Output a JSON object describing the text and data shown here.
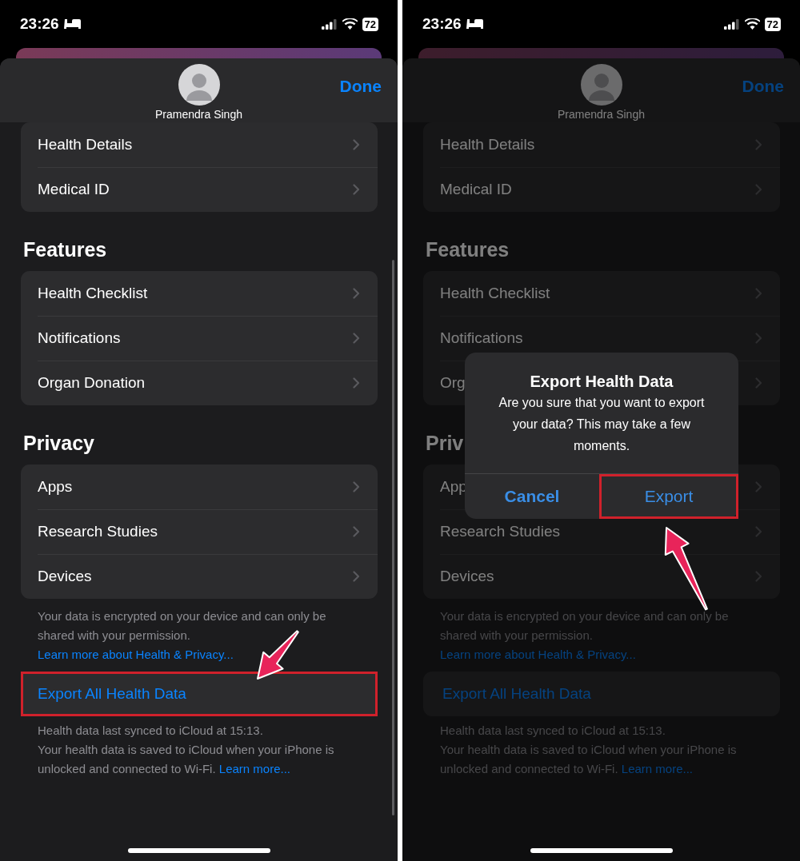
{
  "screens": [
    {
      "dimmed": false,
      "annotation": {
        "kind": "arrow-down"
      },
      "scroll_indicator": true,
      "status_bar": {
        "time": "23:26",
        "battery": "72"
      },
      "profile": {
        "name": "Pramendra Singh"
      },
      "done": "Done",
      "sections": [
        {
          "rows": [
            "Health Details",
            "Medical ID"
          ]
        },
        {
          "title": "Features",
          "rows": [
            "Health Checklist",
            "Notifications",
            "Organ Donation"
          ]
        },
        {
          "title": "Privacy",
          "rows": [
            "Apps",
            "Research Studies",
            "Devices"
          ],
          "footer": {
            "text": "Your data is encrypted on your device and can only be shared with your permission.",
            "link": "Learn more about Health & Privacy..."
          }
        }
      ],
      "export": {
        "label": "Export All Health Data",
        "highlighted": true
      },
      "sync_note": {
        "first_line": "Health data last synced to iCloud at 15:13.",
        "text": "Your health data is saved to iCloud when your iPhone is unlocked and connected to Wi-Fi.",
        "link": "Learn more..."
      }
    },
    {
      "dimmed": true,
      "annotation": {
        "kind": "arrow-up"
      },
      "scroll_indicator": false,
      "status_bar": {
        "time": "23:26",
        "battery": "72"
      },
      "profile": {
        "name": "Pramendra Singh"
      },
      "done": "Done",
      "sections": [
        {
          "rows": [
            "Health Details",
            "Medical ID"
          ]
        },
        {
          "title": "Features",
          "rows": [
            "Health Checklist",
            "Notifications",
            "Org"
          ]
        },
        {
          "title": "Priv",
          "rows": [
            "App",
            "Research Studies",
            "Devices"
          ],
          "footer": {
            "text": "Your data is encrypted on your device and can only be shared with your permission.",
            "link": "Learn more about Health & Privacy..."
          }
        }
      ],
      "export": {
        "label": "Export All Health Data",
        "highlighted": false
      },
      "sync_note": {
        "first_line": "Health data last synced to iCloud at 15:13.",
        "text": "Your health data is saved to iCloud when your iPhone is unlocked and connected to Wi-Fi.",
        "link": "Learn more..."
      },
      "alert": {
        "title": "Export Health Data",
        "message": "Are you sure that you want to export your data? This may take a few moments.",
        "actions": [
          {
            "label": "Cancel",
            "kind": "cancel",
            "highlighted": false
          },
          {
            "label": "Export",
            "kind": "default",
            "highlighted": true
          }
        ]
      }
    }
  ]
}
